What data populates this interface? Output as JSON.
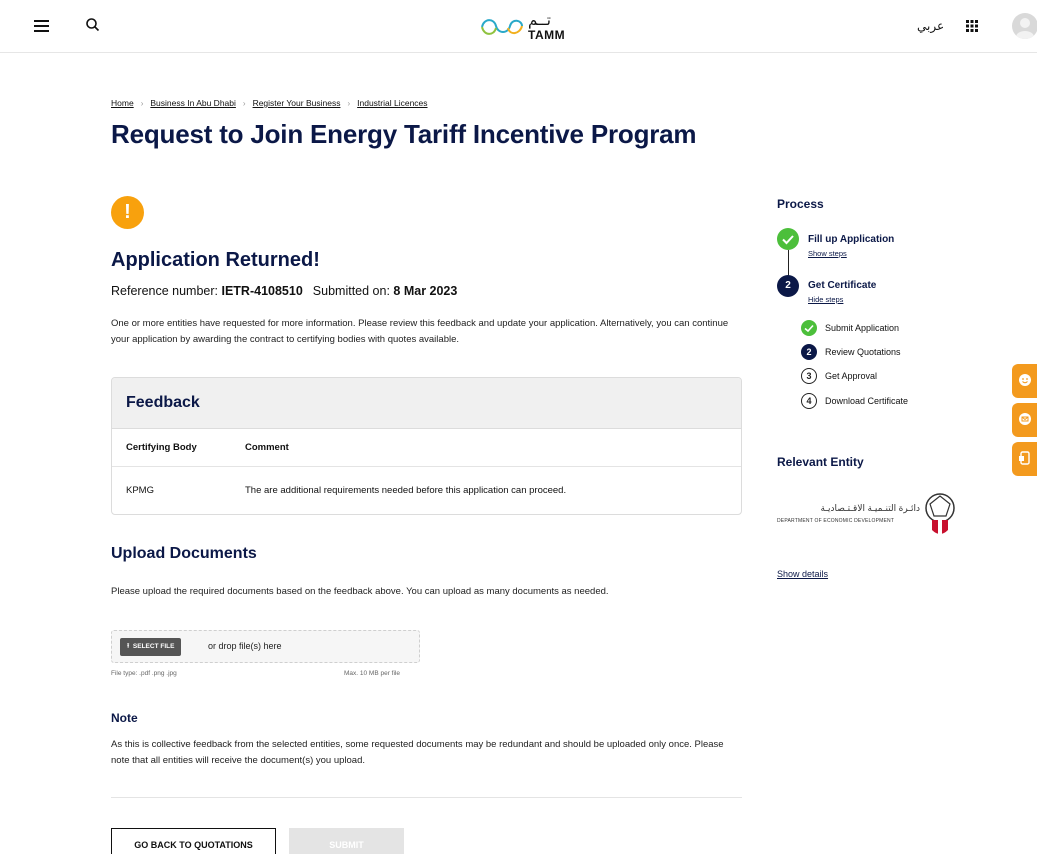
{
  "header": {
    "logo_text": "TAMM",
    "logo_arabic": "تــم",
    "language_label": "عربي"
  },
  "breadcrumb": [
    "Home",
    "Business In Abu Dhabi",
    "Register Your Business",
    "Industrial Licences"
  ],
  "page_title": "Request to Join Energy Tariff Incentive Program",
  "status": {
    "title": "Application Returned!",
    "reference_label": "Reference number: ",
    "reference_value": "IETR-4108510",
    "submitted_label": "Submitted on: ",
    "submitted_value": "8 Mar 2023",
    "description": "One or more entities have requested for more information. Please review this feedback and update your application. Alternatively, you can continue your application by awarding the contract to certifying bodies with quotes available."
  },
  "feedback": {
    "title": "Feedback",
    "columns": [
      "Certifying Body",
      "Comment"
    ],
    "rows": [
      {
        "body": "KPMG",
        "comment": "The are additional requirements needed before this application can proceed."
      }
    ]
  },
  "upload": {
    "title": "Upload Documents",
    "description": "Please upload the required documents based on the feedback above. You can upload as many documents as needed.",
    "select_label": "SELECT FILE",
    "drop_text": "or drop file(s) here",
    "file_types": "File type: .pdf .png .jpg",
    "max_size": "Max. 10 MB per file"
  },
  "note": {
    "title": "Note",
    "text": "As this is collective feedback from the selected entities, some requested documents may be redundant and should be uploaded only once. Please note that all entities will receive the document(s) you upload."
  },
  "actions": {
    "back_label": "GO BACK TO QUOTATIONS",
    "submit_label": "SUBMIT"
  },
  "process": {
    "title": "Process",
    "steps": [
      {
        "label": "Fill up Application",
        "link": "Show steps",
        "state": "done"
      },
      {
        "label": "Get Certificate",
        "link": "Hide steps",
        "state": "current",
        "number": "2"
      }
    ],
    "substeps": [
      {
        "label": "Submit Application",
        "state": "done"
      },
      {
        "label": "Review Quotations",
        "state": "current",
        "number": "2"
      },
      {
        "label": "Get Approval",
        "state": "pending",
        "number": "3"
      },
      {
        "label": "Download Certificate",
        "state": "pending",
        "number": "4"
      }
    ]
  },
  "entity": {
    "title": "Relevant Entity",
    "name_ar": "دائـرة التنـميـة الاقـتـصاديـة",
    "name_en": "DEPARTMENT OF ECONOMIC DEVELOPMENT",
    "details_link": "Show details"
  },
  "colors": {
    "brand_navy": "#0b1847",
    "warning": "#f8a10d",
    "success": "#4cbf3b",
    "side_tab": "#f39a1e"
  }
}
